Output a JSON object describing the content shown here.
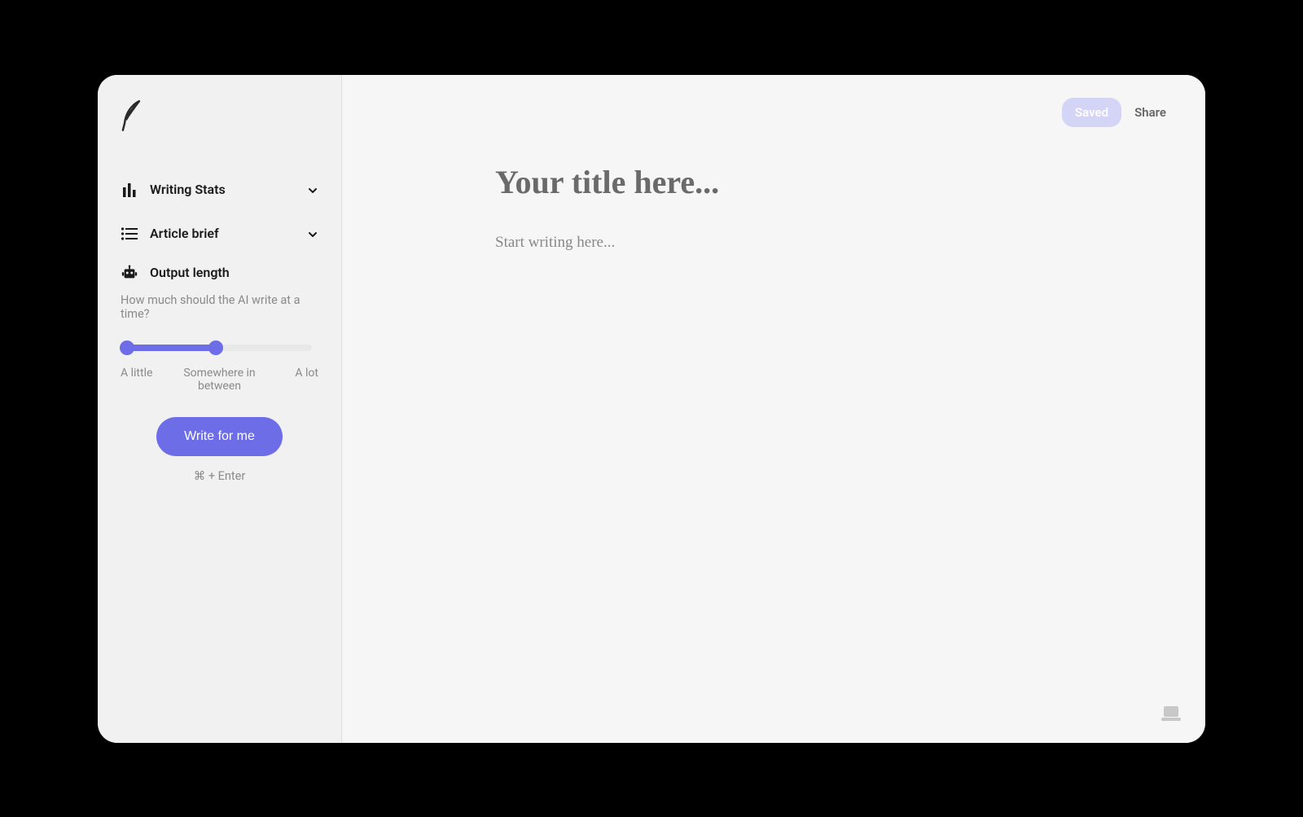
{
  "sidebar": {
    "sections": {
      "writing_stats": {
        "label": "Writing Stats"
      },
      "article_brief": {
        "label": "Article brief"
      }
    },
    "output_length": {
      "title": "Output length",
      "description": "How much should the AI write at a time?",
      "slider": {
        "value_percent": 48,
        "labels": {
          "min": "A little",
          "mid": "Somewhere in between",
          "max": "A lot"
        }
      }
    },
    "write_button": "Write for me",
    "shortcut": "⌘ + Enter"
  },
  "header": {
    "saved_badge": "Saved",
    "share": "Share"
  },
  "editor": {
    "title_placeholder": "Your title here...",
    "body_placeholder": "Start writing here..."
  },
  "colors": {
    "accent": "#6d6de8",
    "badge_bg": "#d4d4f7"
  }
}
